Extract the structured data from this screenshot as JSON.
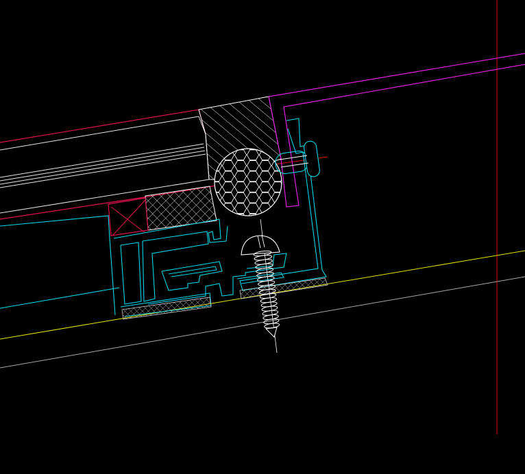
{
  "viewport": {
    "background": "#000000"
  },
  "layer_colors": {
    "glass_outline": "#e0104a",
    "glass_panes": "#e8e8e8",
    "frame_profile": "#00d8e8",
    "panel_outline": "#e020e0",
    "datum_line": "#e8e800",
    "reference_line": "#a8a8a8",
    "axis_line": "#e00000",
    "hatching": "#ffffff",
    "gasket": "#ffffff",
    "screw": "#ffffff"
  },
  "components": [
    {
      "name": "insulated-glass-unit",
      "icon": "glass-pane-icon"
    },
    {
      "name": "structural-sealant",
      "icon": "hatch-icon"
    },
    {
      "name": "backer-rod",
      "icon": "hex-grid-icon"
    },
    {
      "name": "spacer-block",
      "icon": "cross-hatch-icon"
    },
    {
      "name": "setting-block",
      "icon": "x-box-icon"
    },
    {
      "name": "aluminium-frame-profile",
      "icon": "profile-icon"
    },
    {
      "name": "self-tapping-screw",
      "icon": "screw-icon"
    },
    {
      "name": "edge-gasket",
      "icon": "gasket-icon"
    }
  ]
}
